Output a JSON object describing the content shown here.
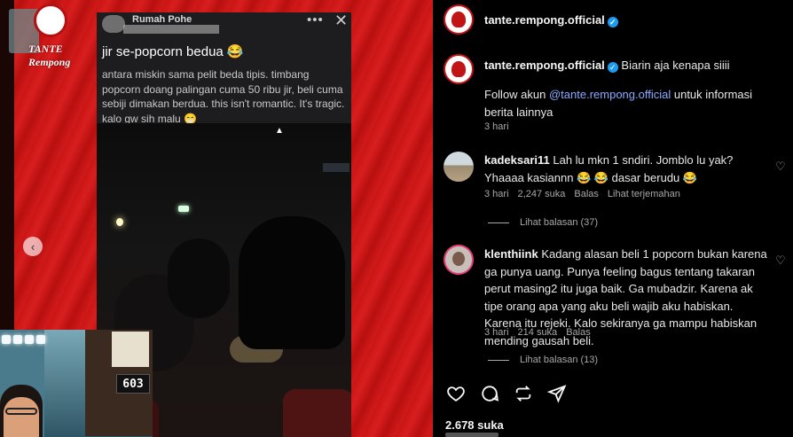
{
  "media": {
    "logo_text": "TANTE Rempong",
    "card": {
      "name": "Rumah Pohe",
      "title": "jir se-popcorn bedua 😂",
      "body": "antara miskin sama pelit beda tipis. timbang popcorn doang palingan cuma 50 ribu jir, beli cuma sebiji dimakan berdua. this isn't romantic. It's tragic. kalo gw sih malu 😁",
      "more_icon": "more-horizontal-icon",
      "close_icon": "close-icon"
    },
    "clock": "603"
  },
  "post": {
    "account": "tante.rempong.official",
    "caption_user": "tante.rempong.official",
    "caption_text": "Biarin aja kenapa siiii",
    "follow_prefix": "Follow akun ",
    "follow_mention": "@tante.rempong.official",
    "follow_suffix": " untuk informasi berita lainnya",
    "caption_time": "3 hari"
  },
  "comments": [
    {
      "user": "kadeksari11",
      "text": "Lah lu mkn 1 sndiri. Jomblo lu yak? Yhaaaa kasiannn 😂 😂  dasar berudu 😂",
      "time": "3 hari",
      "likes": "2,247 suka",
      "reply": "Balas",
      "translate": "Lihat terjemahan",
      "view_replies": "Lihat balasan (37)"
    },
    {
      "user": "klenthiink",
      "text": "Kadang alasan beli 1 popcorn bukan karena ga punya uang. Punya feeling bagus tentang takaran perut masing2 itu juga baik. Ga mubadzir. Karena ak tipe orang apa yang aku beli wajib aku habiskan. Karena itu rejeki. Kalo sekiranya ga mampu habiskan mending gausah beli.",
      "time": "3 hari",
      "likes": "214 suka",
      "reply": "Balas",
      "view_replies": "Lihat balasan (13)"
    }
  ],
  "actions": [
    "heart-icon",
    "comment-icon",
    "repost-icon",
    "share-icon"
  ],
  "likes_total": "2.678 suka",
  "colors": {
    "accent_red": "#d21a1a",
    "mention_blue": "#8aa9ff",
    "verified": "#1d9bf0"
  }
}
